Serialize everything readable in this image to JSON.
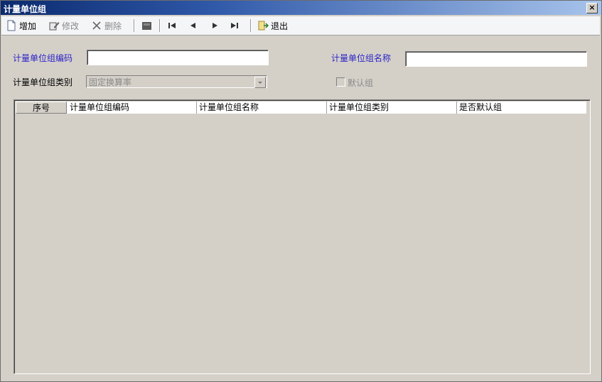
{
  "window": {
    "title": "计量单位组",
    "close_label": "×"
  },
  "toolbar": {
    "add_label": "增加",
    "edit_label": "修改",
    "delete_label": "删除",
    "exit_label": "退出"
  },
  "form": {
    "code_label": "计量单位组编码",
    "code_value": "",
    "name_label": "计量单位组名称",
    "name_value": "",
    "type_label": "计量单位组类别",
    "type_value": "固定换算率",
    "default_label": "默认组"
  },
  "grid": {
    "columns": [
      "序号",
      "计量单位组编码",
      "计量单位组名称",
      "计量单位组类别",
      "是否默认组"
    ],
    "rows": []
  }
}
